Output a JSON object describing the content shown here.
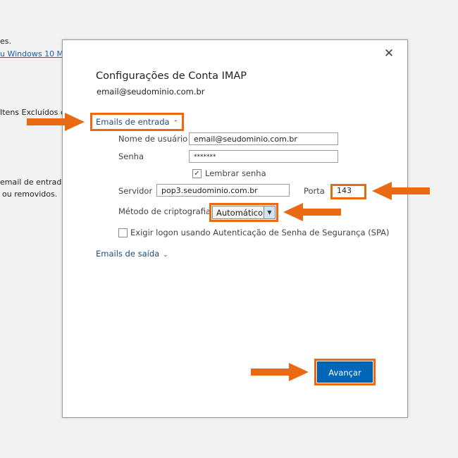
{
  "background": {
    "line1": "es.",
    "line2_link": "u Windows 10 M",
    "line3": "Itens Excluídos e",
    "line4": "email de entrada",
    "line5": "ou removidos."
  },
  "dialog": {
    "title": "Configurações de Conta IMAP",
    "email": "email@seudominio.com.br",
    "close_icon": "close-icon",
    "incoming": {
      "toggle_label": "Emails de entrada",
      "username_label": "Nome de usuário",
      "username_value": "email@seudominio.com.br",
      "password_label": "Senha",
      "password_value": "*******",
      "remember_label": "Lembrar senha",
      "remember_checked": true,
      "server_label": "Servidor",
      "server_value": "pop3.seudominio.com.br",
      "port_label": "Porta",
      "port_value": "143",
      "encryption_label": "Método de criptografia",
      "encryption_value": "Automático",
      "spa_label": "Exigir logon usando Autenticação de Senha de Segurança (SPA)",
      "spa_checked": false
    },
    "outgoing": {
      "toggle_label": "Emails de saída"
    },
    "next_button": "Avançar"
  },
  "annotation": {
    "highlight_color": "#ea6a14"
  }
}
